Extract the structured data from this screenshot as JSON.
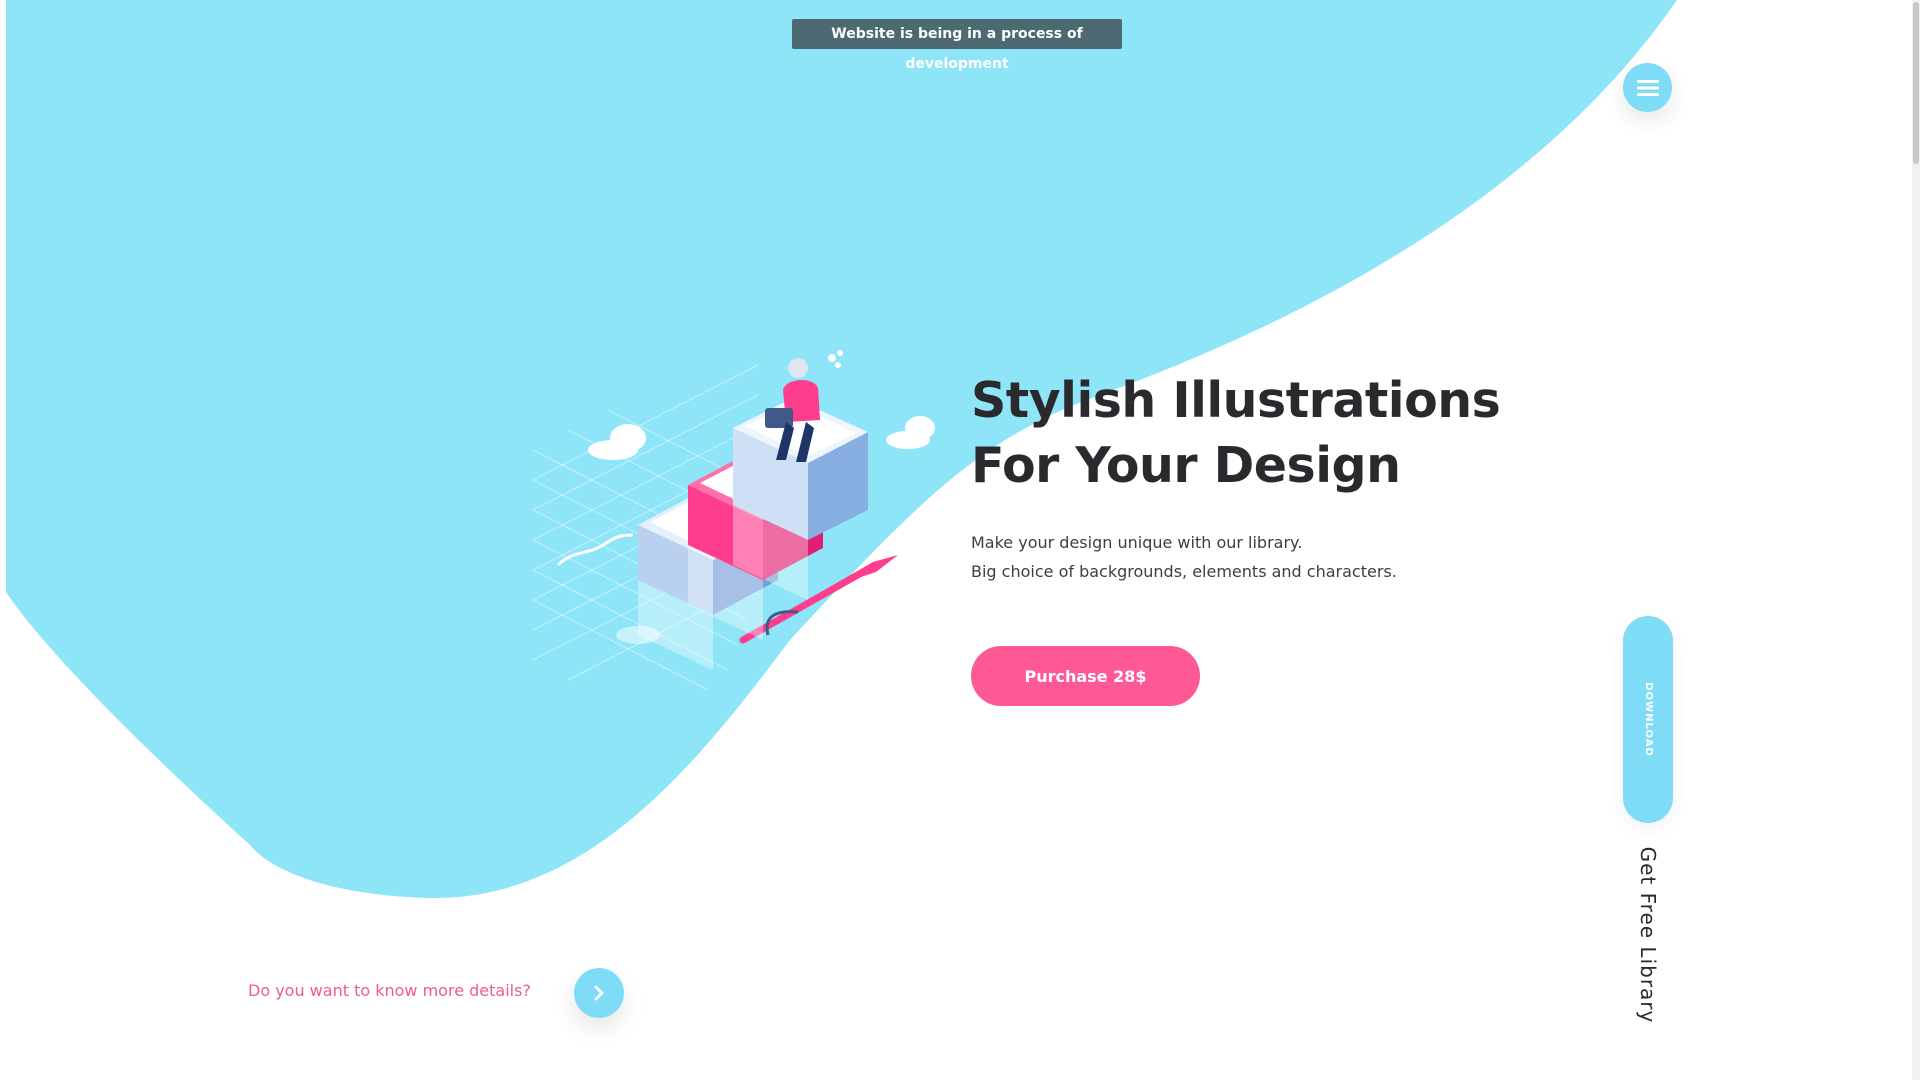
{
  "banner": {
    "text": "Website is being in a process of development"
  },
  "menu": {
    "icon": "hamburger-menu-icon"
  },
  "hero": {
    "title_line1": "Stylish Illustrations",
    "title_line2": "For Your Design",
    "desc_line1": "Make your design unique with our library.",
    "desc_line2": "Big choice of backgrounds, elements and characters.",
    "purchase_label": "Purchase 28$"
  },
  "side": {
    "download_label": "DOWNLOAD",
    "free_library_label": "Get Free Library"
  },
  "footer": {
    "details_text": "Do you want to know more details?",
    "next_icon": "chevron-right-icon"
  },
  "colors": {
    "accent_blue": "#8fe5f8",
    "button_blue": "#7fdcf6",
    "accent_pink": "#ff5995",
    "text_dark": "#2a2a2e",
    "banner_bg": "#4d6a73"
  }
}
